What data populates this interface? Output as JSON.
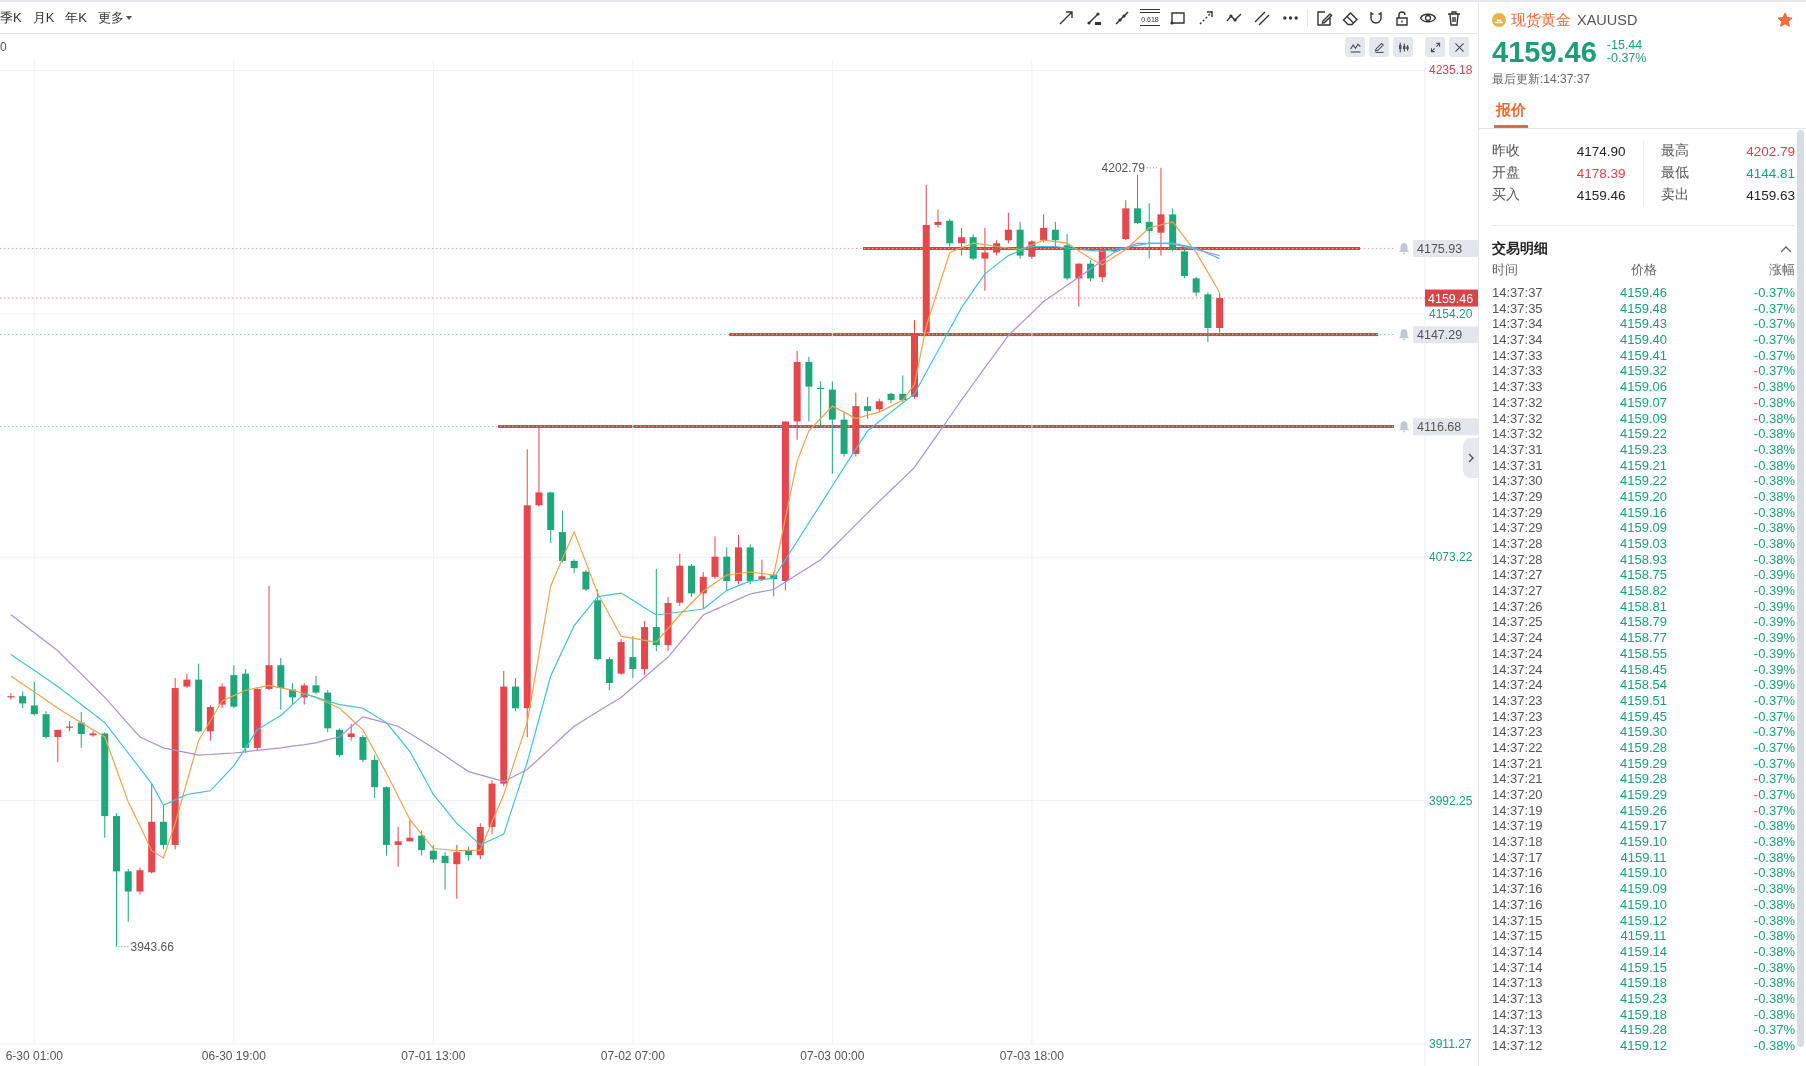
{
  "toolbar": {
    "periods": [
      {
        "label": "季K",
        "selected": false
      },
      {
        "label": "月K",
        "selected": false
      },
      {
        "label": "年K",
        "selected": false
      }
    ],
    "more": "更多",
    "fib_label": "0.618"
  },
  "chart": {
    "header_text": "0",
    "chart_data": [
      {
        "type": "candlestick",
        "categories": [
          null,
          null,
          "6-30 01:00",
          null,
          null,
          null,
          null,
          null,
          null,
          null,
          null,
          null,
          null,
          null,
          null,
          null,
          null,
          null,
          null,
          "06-30 19:00",
          null,
          null,
          null,
          null,
          null,
          null,
          null,
          null,
          null,
          null,
          null,
          null,
          null,
          null,
          null,
          null,
          "07-01 13:00",
          null,
          null,
          null,
          null,
          null,
          null,
          null,
          null,
          null,
          null,
          null,
          null,
          null,
          null,
          null,
          null,
          "07-02 07:00",
          null,
          null,
          null,
          null,
          null,
          null,
          null,
          null,
          null,
          null,
          null,
          null,
          null,
          null,
          null,
          null,
          "07-03 00:00",
          null,
          null,
          null,
          null,
          null,
          null,
          null,
          null,
          null,
          null,
          null,
          null,
          null,
          null,
          null,
          null,
          "07-03 18:00",
          null,
          null,
          null,
          null,
          null,
          null,
          null,
          null,
          null,
          null,
          null,
          null,
          null,
          null,
          null,
          null,
          null,
          null,
          null,
          null,
          null,
          null,
          null,
          null,
          null,
          null,
          null,
          null,
          null,
          null,
          null,
          null,
          null
        ],
        "ohlc": [
          [
            4026.6,
            4028,
            4025.8,
            4027
          ],
          [
            4027,
            4028.5,
            4023,
            4024.6
          ],
          [
            4023.9,
            4031.8,
            4020.6,
            4021
          ],
          [
            4021,
            4022,
            4013,
            4013.4
          ],
          [
            4013.4,
            4015.8,
            4005,
            4015.8
          ],
          [
            4016.5,
            4018.7,
            4015.3,
            4016.9
          ],
          [
            4018.2,
            4021.8,
            4009.8,
            4014.4
          ],
          [
            4014,
            4015.5,
            4013.5,
            4014.6
          ],
          [
            4014.6,
            4015,
            3979.9,
            3987.1
          ],
          [
            3987.1,
            3988,
            3943.66,
            3968.7
          ],
          [
            3968.7,
            3969.5,
            3951.9,
            3962
          ],
          [
            3962,
            3970,
            3961,
            3969.1
          ],
          [
            3968.4,
            3997.9,
            3968,
            3985.2
          ],
          [
            3985.2,
            3990.7,
            3976,
            3977.5
          ],
          [
            3977.5,
            4033,
            3976,
            4029.7
          ],
          [
            4030.2,
            4034.5,
            4029.7,
            4032.5
          ],
          [
            4032.5,
            4037.8,
            4015,
            4015.3
          ],
          [
            4015.3,
            4024,
            4012.2,
            4023.4
          ],
          [
            4024.2,
            4031.3,
            4023,
            4030.2
          ],
          [
            4034,
            4037.3,
            4023,
            4023.5
          ],
          [
            4034.5,
            4036,
            4008,
            4009.8
          ],
          [
            4009.8,
            4030,
            4009,
            4029.4
          ],
          [
            4029.4,
            4063.7,
            4029,
            4037.3
          ],
          [
            4037.3,
            4039.7,
            4022.5,
            4029.7
          ],
          [
            4029.2,
            4031.3,
            4024.2,
            4026.6
          ],
          [
            4026.6,
            4031.3,
            4024.2,
            4030.6
          ],
          [
            4030.6,
            4033.7,
            4027.7,
            4028.2
          ],
          [
            4028.2,
            4029,
            4015,
            4016.3
          ],
          [
            4015.8,
            4016.3,
            4006.7,
            4007.4
          ],
          [
            4013.4,
            4017.7,
            4012.2,
            4014.6
          ],
          [
            4013.4,
            4014.1,
            4005,
            4005.8
          ],
          [
            4005.8,
            4007.4,
            3993.1,
            3996.7
          ],
          [
            3996.7,
            3997,
            3973.9,
            3977.5
          ],
          [
            3977.5,
            3983.5,
            3970.3,
            3978.7
          ],
          [
            3978.7,
            3985.9,
            3978.7,
            3979.9
          ],
          [
            3980.6,
            3982.3,
            3974,
            3975.8
          ],
          [
            3975.6,
            3977.5,
            3971.5,
            3972.7
          ],
          [
            3973.9,
            3975.1,
            3962.7,
            3971.5
          ],
          [
            3971.1,
            3977.5,
            3959.6,
            3975.1
          ],
          [
            3975.8,
            3977,
            3972.3,
            3974.1
          ],
          [
            3974.1,
            3984.7,
            3972.7,
            3983.5
          ],
          [
            3983.5,
            3999,
            3981.1,
            3997.9
          ],
          [
            3997.9,
            4035.4,
            3997,
            4030.2
          ],
          [
            4030.2,
            4033,
            4022,
            4023
          ],
          [
            4023,
            4109.1,
            4013.4,
            4090.5
          ],
          [
            4090.5,
            4116.3,
            4090,
            4094.8
          ],
          [
            4094.8,
            4095,
            4078,
            4082.3
          ],
          [
            4081.6,
            4088.8,
            4071.5,
            4072
          ],
          [
            4072,
            4072.5,
            4068,
            4069.6
          ],
          [
            4068.4,
            4069,
            4062,
            4062.5
          ],
          [
            4058.9,
            4062.5,
            4039,
            4039.3
          ],
          [
            4039.3,
            4040,
            4029,
            4031.4
          ],
          [
            4034.5,
            4046,
            4034,
            4045
          ],
          [
            4040,
            4047,
            4033,
            4036
          ],
          [
            4036,
            4052,
            4034,
            4050
          ],
          [
            4050,
            4069.3,
            4042,
            4044
          ],
          [
            4044,
            4060,
            4042,
            4058
          ],
          [
            4058.1,
            4074.4,
            4057,
            4070.4
          ],
          [
            4070.4,
            4071,
            4060,
            4061.2
          ],
          [
            4061.2,
            4068.3,
            4056,
            4066.7
          ],
          [
            4066.7,
            4080.2,
            4066,
            4073.4
          ],
          [
            4073.4,
            4076.5,
            4062.2,
            4065.3
          ],
          [
            4065.3,
            4080.6,
            4064.2,
            4076.5
          ],
          [
            4076.5,
            4077.5,
            4064.2,
            4065.3
          ],
          [
            4065.9,
            4072.4,
            4065.3,
            4066.9
          ],
          [
            4067.3,
            4068.3,
            4060.2,
            4065.9
          ],
          [
            4065.3,
            4118.4,
            4062.2,
            4118.4
          ],
          [
            4118.4,
            4141.9,
            4112.3,
            4138.2
          ],
          [
            4138.2,
            4139.9,
            4118.4,
            4130
          ],
          [
            4129.6,
            4131.7,
            4116.3,
            4129.2
          ],
          [
            4129,
            4131.7,
            4101,
            4119
          ],
          [
            4119,
            4121.5,
            4106.7,
            4107.6
          ],
          [
            4107.6,
            4128,
            4106.7,
            4123.5
          ],
          [
            4123.5,
            4126.6,
            4119.4,
            4121.9
          ],
          [
            4122.5,
            4126,
            4121.5,
            4125.1
          ],
          [
            4127.6,
            4128,
            4124.5,
            4125.5
          ],
          [
            4127.6,
            4133.7,
            4125,
            4125.5
          ],
          [
            4126.6,
            4152.1,
            4126,
            4147.6
          ],
          [
            4148,
            4197.1,
            4147,
            4183.8
          ],
          [
            4183.8,
            4188.9,
            4182.8,
            4184.8
          ],
          [
            4185.2,
            4185.8,
            4176.6,
            4177.7
          ],
          [
            4177.7,
            4182.8,
            4173.6,
            4179.7
          ],
          [
            4179.7,
            4180.7,
            4172,
            4172.6
          ],
          [
            4172.6,
            4182.8,
            4161.9,
            4174.6
          ],
          [
            4174.6,
            4178.7,
            4173.6,
            4177.7
          ],
          [
            4178.7,
            4187.9,
            4177.7,
            4182.2
          ],
          [
            4182.2,
            4184.8,
            4172.6,
            4173.6
          ],
          [
            4173.2,
            4178.7,
            4172.6,
            4178.3
          ],
          [
            4178.7,
            4187.3,
            4178,
            4182.8
          ],
          [
            4182.2,
            4184.8,
            4176.6,
            4178.7
          ],
          [
            4177,
            4180.7,
            4165.4,
            4166
          ],
          [
            4166,
            4171,
            4156.6,
            4170.9
          ],
          [
            4170.9,
            4172,
            4165,
            4166
          ],
          [
            4166.4,
            4176.6,
            4164.8,
            4175.6
          ],
          [
            4175.6,
            4176.2,
            4174.6,
            4175
          ],
          [
            4179.1,
            4192,
            4178.7,
            4189.3
          ],
          [
            4189.3,
            4200.5,
            4184,
            4184.4
          ],
          [
            4184.8,
            4191,
            4172.6,
            4181.8
          ],
          [
            4181.2,
            4202.79,
            4173.6,
            4187.3
          ],
          [
            4187.3,
            4189.3,
            4175,
            4175.6
          ],
          [
            4175,
            4176.6,
            4166,
            4166.8
          ],
          [
            4166,
            4166.5,
            4160,
            4161.3
          ],
          [
            4160.7,
            4161.3,
            4144.81,
            4149.5
          ],
          [
            4149.5,
            4161,
            4148,
            4159.46
          ],
          null,
          null,
          null,
          null,
          null,
          null,
          null,
          null,
          null,
          null,
          null,
          null,
          null,
          null,
          null,
          null,
          null
        ],
        "series": [
          {
            "type": "line",
            "color": "#f2a24f",
            "values": [
              4033.7,
              4031.0,
              4028.4,
              4025.7,
              4023.0,
              4020.6,
              4018.2,
              4015.8,
              4013.4,
              4002.7,
              3991.9,
              3983.8,
              3975.6,
              3973.2,
              3984.7,
              3998.5,
              4012.2,
              4018.8,
              4025.4,
              4027.2,
              4029.0,
              4029.8,
              4030.6,
              4029.8,
              4029.0,
              4027.8,
              4026.6,
              4024.8,
              4023.0,
              4019.4,
              4015.8,
              4008.6,
              4001.4,
              3993.7,
              3985.9,
              3981.1,
              3976.3,
              3976.0,
              3975.6,
              3975.7,
              3975.8,
              3985.1,
              3994.3,
              4006.3,
              4018.2,
              4041.0,
              4063.7,
              4072.7,
              4081.6,
              4071.5,
              4061.3,
              4054.1,
              4046.9,
              4046.3,
              4045.6,
              4045.0,
              4049.5,
              4054.0,
              4058.0,
              4062.0,
              4064.7,
              4067.3,
              4067.8,
              4068.3,
              4067.8,
              4067.3,
              4086.2,
              4105.1,
              4115.3,
              4119.4,
              4123.5,
              4121.5,
              4119.4,
              4120.5,
              4121.5,
              4123.5,
              4125.5,
              4130.7,
              4150.0,
              4162.3,
              4174.6,
              4176.2,
              4177.7,
              4177.2,
              4176.6,
              4176.1,
              4175.6,
              4177.2,
              4178.7,
              4178.2,
              4177.7,
              4175.2,
              4172.6,
              4170.5,
              4173.1,
              4175.6,
              4179.2,
              4182.8,
              4183.8,
              4184.8,
              4179.7,
              4174.6,
              4168.0,
              4161.3,
              null,
              null,
              null,
              null,
              null,
              null,
              null,
              null,
              null,
              null,
              null,
              null,
              null,
              null,
              null,
              null,
              null
            ]
          },
          {
            "type": "line",
            "color": "#3fc3da",
            "values": [
              4040.9,
              4038.2,
              4035.6,
              4032.9,
              4030.2,
              4027.2,
              4024.2,
              4021.2,
              4018.2,
              4013.1,
              4008.1,
              4003.0,
              3997.9,
              3990.7,
              3992.5,
              3994.3,
              3994.9,
              3995.5,
              3999.7,
              4003.8,
              4009.8,
              4015.8,
              4018.2,
              4020.6,
              4024.2,
              4027.8,
              4026.6,
              4025.4,
              4024.2,
              4023.6,
              4023.0,
              4020.6,
              4018.2,
              4013.4,
              4008.6,
              4001.5,
              3994.3,
              3989.5,
              3984.7,
              3981.1,
              3977.5,
              3979.3,
              3981.1,
              3993.1,
              4005.0,
              4019.4,
              4033.7,
              4042.1,
              4050.5,
              4055.3,
              4060.1,
              4060.7,
              4061.3,
              4058.9,
              4056.4,
              4054.0,
              4054.5,
              4055.0,
              4055.5,
              4056.0,
              4059.1,
              4062.2,
              4063.8,
              4065.3,
              4065.8,
              4066.3,
              4072.4,
              4078.5,
              4084.7,
              4090.8,
              4097.0,
              4103.1,
              4109.2,
              4115.3,
              4118.4,
              4121.5,
              4124.6,
              4127.6,
              4134.8,
              4141.9,
              4149.1,
              4156.2,
              4161.9,
              4167.5,
              4170.6,
              4173.6,
              4175.1,
              4176.6,
              4176.6,
              4176.6,
              4176.1,
              4175.6,
              4175.3,
              4175.0,
              4175.6,
              4176.2,
              4177.0,
              4177.7,
              4177.7,
              4177.7,
              4176.9,
              4176.0,
              4174.3,
              4172.6,
              null,
              null,
              null,
              null,
              null,
              null,
              null,
              null,
              null,
              null,
              null,
              null,
              null,
              null,
              null,
              null,
              null
            ]
          },
          {
            "type": "line",
            "color": "#a892dc",
            "values": [
              4054.1,
              4051.1,
              4048.1,
              4045.1,
              4042.1,
              4038.2,
              4034.4,
              4030.5,
              4026.6,
              4022.2,
              4017.8,
              4013.4,
              4011.6,
              4009.8,
              4009.0,
              4008.2,
              4007.4,
              4007.6,
              4007.9,
              4008.1,
              4008.5,
              4009.0,
              4009.4,
              4009.8,
              4010.4,
              4010.9,
              4011.5,
              4012.5,
              4013.4,
              4016.8,
              4020.1,
              4019.1,
              4018.0,
              4017.0,
              4014.6,
              4012.2,
              4009.8,
              4007.2,
              4004.5,
              4001.9,
              4000.8,
              3999.7,
              3998.6,
              4000.6,
              4002.6,
              4006.2,
              4009.8,
              4013.4,
              4017.0,
              4019.4,
              4021.8,
              4024.2,
              4026.6,
              4030.0,
              4033.3,
              4036.7,
              4040.0,
              4044.7,
              4049.3,
              4054.0,
              4055.8,
              4057.5,
              4059.3,
              4061.0,
              4061.8,
              4062.5,
              4065.0,
              4067.5,
              4069.9,
              4072.4,
              4076.3,
              4080.2,
              4084.1,
              4088.0,
              4091.8,
              4095.6,
              4099.3,
              4103.1,
              4108.7,
              4114.3,
              4119.9,
              4125.5,
              4130.9,
              4136.3,
              4141.6,
              4147.0,
              4150.8,
              4154.5,
              4158.3,
              4161.0,
              4163.7,
              4166.4,
              4169.1,
              4171.9,
              4174.6,
              4176.2,
              4177.7,
              4177.6,
              4177.6,
              4177.5,
              4176.5,
              4175.6,
              4174.6,
              4173.6,
              null,
              null,
              null,
              null,
              null,
              null,
              null,
              null,
              null,
              null,
              null,
              null,
              null,
              null,
              null,
              null,
              null
            ]
          }
        ],
        "ylim": [
          3911.27,
          4238
        ],
        "yticks": [
          {
            "value": 3911.27,
            "label": "3911.27"
          },
          {
            "value": 3992.25,
            "label": "3992.25"
          },
          {
            "value": 4073.22,
            "label": "4073.22"
          },
          {
            "value": 4154.2,
            "label": "4154.20"
          },
          {
            "value": 4235.18,
            "label": "4235.18"
          }
        ],
        "grid": true,
        "ref_lines": [
          {
            "axis": "y",
            "value": 4175.93,
            "label": "4175.93",
            "color": "#e6a3a7",
            "line_style": "dotted"
          },
          {
            "axis": "y",
            "value": 4159.46,
            "label": "4159.46",
            "color": "#e8888d",
            "line_style": "dotted"
          },
          {
            "axis": "y",
            "value": 4147.29,
            "label": "4147.29",
            "color": "#7fcdb3",
            "line_style": "dotted"
          },
          {
            "axis": "y",
            "value": 4116.68,
            "label": "4116.68",
            "color": "#7fcdb3",
            "line_style": "dotted"
          }
        ],
        "annotations": [
          "4202.79",
          "3943.66"
        ]
      }
    ]
  },
  "quote": {
    "name": "现货黄金",
    "symbol": "XAUUSD",
    "favorite": true,
    "price": "4159.46",
    "change": "-15.44",
    "change_pct": "-0.37%",
    "falling": true,
    "updated": "最后更新:14:37:37"
  },
  "tabs": [
    {
      "label": "报价",
      "selected": true
    }
  ],
  "stats": [
    {
      "label": "昨收",
      "value": "4174.90",
      "color": "#222222"
    },
    {
      "label": "最高",
      "value": "4202.79",
      "color": "#d9434a"
    },
    {
      "label": "开盘",
      "value": "4178.39",
      "color": "#d9434a"
    },
    {
      "label": "最低",
      "value": "4144.81",
      "color": "#1a9f78"
    },
    {
      "label": "买入",
      "value": "4159.46",
      "color": "#222222"
    },
    {
      "label": "卖出",
      "value": "4159.63",
      "color": "#222222"
    }
  ],
  "trades": {
    "title": "交易明细",
    "expanded": true,
    "columns": [
      "时间",
      "价格",
      "涨幅"
    ],
    "rows": [
      {
        "time": "14:37:37",
        "price": "4159.46",
        "change": "-0.37%",
        "falling": true
      },
      {
        "time": "14:37:35",
        "price": "4159.48",
        "change": "-0.37%",
        "falling": true
      },
      {
        "time": "14:37:34",
        "price": "4159.43",
        "change": "-0.37%",
        "falling": true
      },
      {
        "time": "14:37:34",
        "price": "4159.40",
        "change": "-0.37%",
        "falling": true
      },
      {
        "time": "14:37:33",
        "price": "4159.41",
        "change": "-0.37%",
        "falling": true
      },
      {
        "time": "14:37:33",
        "price": "4159.32",
        "change": "-0.37%",
        "falling": true
      },
      {
        "time": "14:37:33",
        "price": "4159.06",
        "change": "-0.38%",
        "falling": true
      },
      {
        "time": "14:37:32",
        "price": "4159.07",
        "change": "-0.38%",
        "falling": true
      },
      {
        "time": "14:37:32",
        "price": "4159.09",
        "change": "-0.38%",
        "falling": true
      },
      {
        "time": "14:37:32",
        "price": "4159.22",
        "change": "-0.38%",
        "falling": true
      },
      {
        "time": "14:37:31",
        "price": "4159.23",
        "change": "-0.38%",
        "falling": true
      },
      {
        "time": "14:37:31",
        "price": "4159.21",
        "change": "-0.38%",
        "falling": true
      },
      {
        "time": "14:37:30",
        "price": "4159.22",
        "change": "-0.38%",
        "falling": true
      },
      {
        "time": "14:37:29",
        "price": "4159.20",
        "change": "-0.38%",
        "falling": true
      },
      {
        "time": "14:37:29",
        "price": "4159.16",
        "change": "-0.38%",
        "falling": true
      },
      {
        "time": "14:37:29",
        "price": "4159.09",
        "change": "-0.38%",
        "falling": true
      },
      {
        "time": "14:37:28",
        "price": "4159.03",
        "change": "-0.38%",
        "falling": true
      },
      {
        "time": "14:37:28",
        "price": "4158.93",
        "change": "-0.38%",
        "falling": true
      },
      {
        "time": "14:37:27",
        "price": "4158.75",
        "change": "-0.39%",
        "falling": true
      },
      {
        "time": "14:37:27",
        "price": "4158.82",
        "change": "-0.39%",
        "falling": true
      },
      {
        "time": "14:37:26",
        "price": "4158.81",
        "change": "-0.39%",
        "falling": true
      },
      {
        "time": "14:37:25",
        "price": "4158.79",
        "change": "-0.39%",
        "falling": true
      },
      {
        "time": "14:37:24",
        "price": "4158.77",
        "change": "-0.39%",
        "falling": true
      },
      {
        "time": "14:37:24",
        "price": "4158.55",
        "change": "-0.39%",
        "falling": true
      },
      {
        "time": "14:37:24",
        "price": "4158.45",
        "change": "-0.39%",
        "falling": true
      },
      {
        "time": "14:37:24",
        "price": "4158.54",
        "change": "-0.39%",
        "falling": true
      },
      {
        "time": "14:37:23",
        "price": "4159.51",
        "change": "-0.37%",
        "falling": true
      },
      {
        "time": "14:37:23",
        "price": "4159.45",
        "change": "-0.37%",
        "falling": true
      },
      {
        "time": "14:37:23",
        "price": "4159.30",
        "change": "-0.37%",
        "falling": true
      },
      {
        "time": "14:37:22",
        "price": "4159.28",
        "change": "-0.37%",
        "falling": true
      },
      {
        "time": "14:37:21",
        "price": "4159.29",
        "change": "-0.37%",
        "falling": true
      },
      {
        "time": "14:37:21",
        "price": "4159.28",
        "change": "-0.37%",
        "falling": true
      },
      {
        "time": "14:37:20",
        "price": "4159.29",
        "change": "-0.37%",
        "falling": true
      },
      {
        "time": "14:37:19",
        "price": "4159.26",
        "change": "-0.37%",
        "falling": true
      },
      {
        "time": "14:37:19",
        "price": "4159.17",
        "change": "-0.38%",
        "falling": true
      },
      {
        "time": "14:37:18",
        "price": "4159.10",
        "change": "-0.38%",
        "falling": true
      },
      {
        "time": "14:37:17",
        "price": "4159.11",
        "change": "-0.38%",
        "falling": true
      },
      {
        "time": "14:37:16",
        "price": "4159.10",
        "change": "-0.38%",
        "falling": true
      },
      {
        "time": "14:37:16",
        "price": "4159.09",
        "change": "-0.38%",
        "falling": true
      },
      {
        "time": "14:37:16",
        "price": "4159.10",
        "change": "-0.38%",
        "falling": true
      },
      {
        "time": "14:37:15",
        "price": "4159.12",
        "change": "-0.38%",
        "falling": true
      },
      {
        "time": "14:37:15",
        "price": "4159.11",
        "change": "-0.38%",
        "falling": true
      },
      {
        "time": "14:37:14",
        "price": "4159.14",
        "change": "-0.38%",
        "falling": true
      },
      {
        "time": "14:37:14",
        "price": "4159.15",
        "change": "-0.38%",
        "falling": true
      },
      {
        "time": "14:37:13",
        "price": "4159.18",
        "change": "-0.38%",
        "falling": true
      },
      {
        "time": "14:37:13",
        "price": "4159.23",
        "change": "-0.38%",
        "falling": true
      },
      {
        "time": "14:37:13",
        "price": "4159.18",
        "change": "-0.38%",
        "falling": true
      },
      {
        "time": "14:37:13",
        "price": "4159.28",
        "change": "-0.37%",
        "falling": true
      },
      {
        "time": "14:37:12",
        "price": "4159.12",
        "change": "-0.38%",
        "falling": true
      }
    ]
  }
}
